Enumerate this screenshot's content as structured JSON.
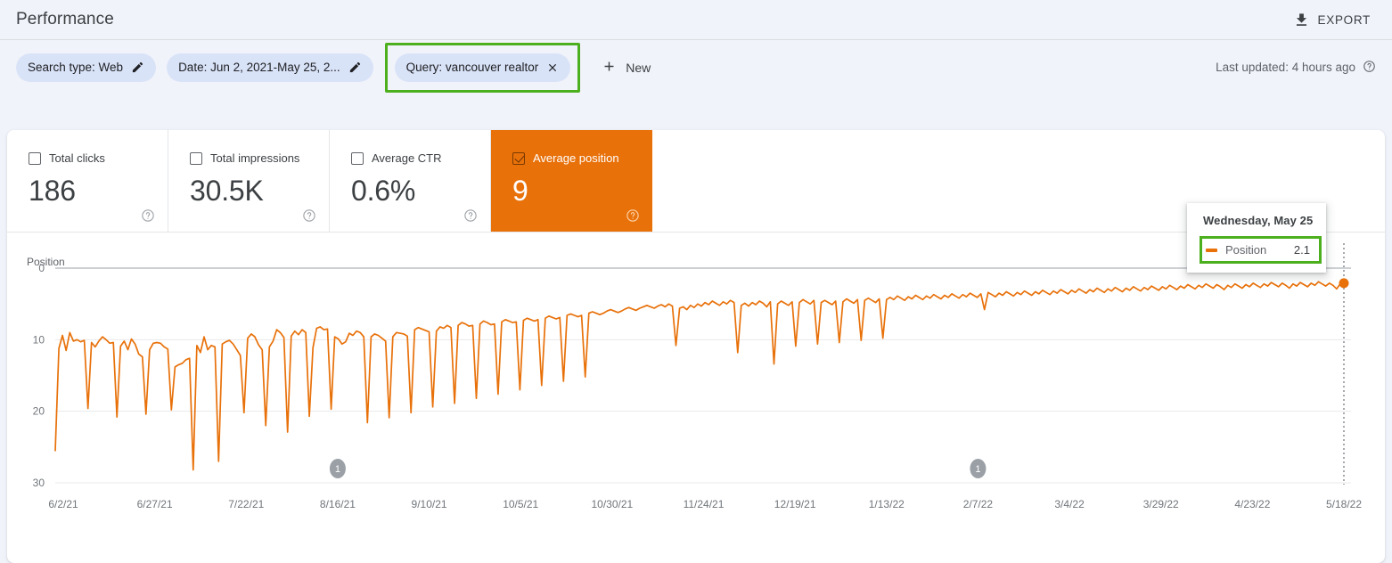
{
  "header": {
    "title": "Performance",
    "export_label": "EXPORT",
    "export_icon": "download-icon"
  },
  "filters": {
    "chips": [
      {
        "label": "Search type: Web",
        "action": "edit",
        "action_icon": "pencil-icon",
        "highlighted": false
      },
      {
        "label": "Date: Jun 2, 2021-May 25, 2...",
        "action": "edit",
        "action_icon": "pencil-icon",
        "highlighted": false
      },
      {
        "label": "Query: vancouver realtor",
        "action": "remove",
        "action_icon": "close-icon",
        "highlighted": true
      }
    ],
    "new_label": "New",
    "new_icon": "plus-icon",
    "last_updated": "Last updated: 4 hours ago",
    "last_updated_icon": "help-icon"
  },
  "metrics": [
    {
      "label": "Total clicks",
      "value": "186",
      "selected": false,
      "checkbox_icon": "checkbox-unchecked-icon",
      "help_icon": "help-icon"
    },
    {
      "label": "Total impressions",
      "value": "30.5K",
      "selected": false,
      "checkbox_icon": "checkbox-unchecked-icon",
      "help_icon": "help-icon"
    },
    {
      "label": "Average CTR",
      "value": "0.6%",
      "selected": false,
      "checkbox_icon": "checkbox-unchecked-icon",
      "help_icon": "help-icon"
    },
    {
      "label": "Average position",
      "value": "9",
      "selected": true,
      "checkbox_icon": "checkbox-checked-icon",
      "help_icon": "help-icon"
    }
  ],
  "tooltip": {
    "date": "Wednesday, May 25",
    "series_name": "Position",
    "series_value": "2.1",
    "swatch_color": "#E8710A",
    "highlight_color": "#4CAF1E"
  },
  "colors": {
    "accent": "#E8710A",
    "highlight": "#4CAF1E",
    "chip_bg": "#D9E3F8",
    "page_bg": "#F1F3FA",
    "card_bg": "#FFFFFF",
    "text": "#3c4043",
    "muted_text": "#70757a"
  },
  "annotations": [
    {
      "label": "1",
      "x_date": "8/16/21"
    },
    {
      "label": "1",
      "x_date": "2/7/22"
    }
  ],
  "chart_data": {
    "type": "line",
    "title": "",
    "xlabel": "",
    "ylabel": "Position",
    "y_axis_inverted": true,
    "ylim": [
      0,
      30
    ],
    "yticks": [
      0,
      10,
      20,
      30
    ],
    "grid": true,
    "legend": "none",
    "series_name": "Position",
    "series_color": "#E8710A",
    "xticks": [
      "6/2/21",
      "6/27/21",
      "7/22/21",
      "8/16/21",
      "9/10/21",
      "10/5/21",
      "10/30/21",
      "11/24/21",
      "12/19/21",
      "1/13/22",
      "2/7/22",
      "3/4/22",
      "3/29/22",
      "4/23/22",
      "5/18/22"
    ],
    "x_range": [
      "6/2/21",
      "5/25/22"
    ],
    "highlighted_point": {
      "date": "Wednesday, May 25",
      "value": 2.1
    },
    "description": "Daily average position, trending from ~11 down (better) to ~2 over the year, with regular deep downward spikes to positions 18-28.",
    "values": [
      25.5,
      11.2,
      9.4,
      11.5,
      9.0,
      10.2,
      10.0,
      10.3,
      10.1,
      19.6,
      10.4,
      11.0,
      10.2,
      9.6,
      10.0,
      10.5,
      10.4,
      20.8,
      10.9,
      10.2,
      11.4,
      9.9,
      10.6,
      12.0,
      12.4,
      20.4,
      11.4,
      10.5,
      10.4,
      10.5,
      11.0,
      11.3,
      19.8,
      13.8,
      13.5,
      13.3,
      12.8,
      12.6,
      28.2,
      10.8,
      11.8,
      9.6,
      11.4,
      10.8,
      11.0,
      27.0,
      10.6,
      10.3,
      10.1,
      10.6,
      11.4,
      12.2,
      20.2,
      9.8,
      9.2,
      9.6,
      10.7,
      11.4,
      22.0,
      11.0,
      10.2,
      8.6,
      9.0,
      9.7,
      22.9,
      9.5,
      8.8,
      9.3,
      8.6,
      9.0,
      20.7,
      11.1,
      8.4,
      8.2,
      8.6,
      8.5,
      19.7,
      9.6,
      9.9,
      10.6,
      10.3,
      9.1,
      9.4,
      8.8,
      9.0,
      9.6,
      21.6,
      9.6,
      9.2,
      9.4,
      9.8,
      10.2,
      20.9,
      9.6,
      9.0,
      9.1,
      9.2,
      9.5,
      20.2,
      8.6,
      8.3,
      8.5,
      8.7,
      8.9,
      19.4,
      8.8,
      8.2,
      8.4,
      8.0,
      8.3,
      18.9,
      8.0,
      7.6,
      7.8,
      8.1,
      8.0,
      18.2,
      7.8,
      7.4,
      7.6,
      7.9,
      7.8,
      17.6,
      7.5,
      7.2,
      7.4,
      7.6,
      7.5,
      17.0,
      7.3,
      7.0,
      7.2,
      7.4,
      7.2,
      16.4,
      7.0,
      6.7,
      6.9,
      7.1,
      6.9,
      15.8,
      6.6,
      6.4,
      6.6,
      6.8,
      6.6,
      15.2,
      6.3,
      6.1,
      6.3,
      6.5,
      6.3,
      6.0,
      5.8,
      6.0,
      6.2,
      6.0,
      5.7,
      5.5,
      5.7,
      5.9,
      5.6,
      5.4,
      5.2,
      5.4,
      5.6,
      5.3,
      5.1,
      5.4,
      5.0,
      5.3,
      10.8,
      5.6,
      5.4,
      5.8,
      5.2,
      5.5,
      5.0,
      5.3,
      4.8,
      5.1,
      4.6,
      4.9,
      5.2,
      4.7,
      5.0,
      4.5,
      4.8,
      11.8,
      5.2,
      4.9,
      5.3,
      4.8,
      5.1,
      4.6,
      4.9,
      5.4,
      4.7,
      13.4,
      5.0,
      4.6,
      4.9,
      5.2,
      4.7,
      10.9,
      4.8,
      4.4,
      4.7,
      5.0,
      4.5,
      10.6,
      4.8,
      4.5,
      4.8,
      5.1,
      4.6,
      10.4,
      4.7,
      4.3,
      4.6,
      4.9,
      4.4,
      10.1,
      4.5,
      4.2,
      4.5,
      4.8,
      4.3,
      9.8,
      4.4,
      4.1,
      4.4,
      3.9,
      4.2,
      4.5,
      4.0,
      4.3,
      3.8,
      4.1,
      4.4,
      3.9,
      4.2,
      3.7,
      4.0,
      4.3,
      3.8,
      4.1,
      3.6,
      3.9,
      4.2,
      3.7,
      4.0,
      3.5,
      3.8,
      4.1,
      3.6,
      5.8,
      3.4,
      3.7,
      4.0,
      3.5,
      3.8,
      3.3,
      3.6,
      3.9,
      3.4,
      3.7,
      3.2,
      3.5,
      3.8,
      3.3,
      3.6,
      3.1,
      3.4,
      3.7,
      3.2,
      3.5,
      3.0,
      3.3,
      3.6,
      3.1,
      3.4,
      2.9,
      3.2,
      3.5,
      3.0,
      3.3,
      2.8,
      3.1,
      3.4,
      2.9,
      3.2,
      2.7,
      3.0,
      3.3,
      2.8,
      3.1,
      2.6,
      2.9,
      3.2,
      2.7,
      3.0,
      2.5,
      2.8,
      3.1,
      2.6,
      2.9,
      2.4,
      2.7,
      3.0,
      2.5,
      2.8,
      2.3,
      2.6,
      2.9,
      2.4,
      2.7,
      2.2,
      2.5,
      2.8,
      2.3,
      2.6,
      3.0,
      2.4,
      2.7,
      2.2,
      2.5,
      2.8,
      2.3,
      2.6,
      2.1,
      2.4,
      2.7,
      2.2,
      2.5,
      2.0,
      2.3,
      2.6,
      2.1,
      2.4,
      2.8,
      2.2,
      2.5,
      2.0,
      2.3,
      2.6,
      2.1,
      2.4,
      1.9,
      2.2,
      2.5,
      2.1,
      2.4,
      2.9,
      2.2,
      2.1
    ]
  }
}
